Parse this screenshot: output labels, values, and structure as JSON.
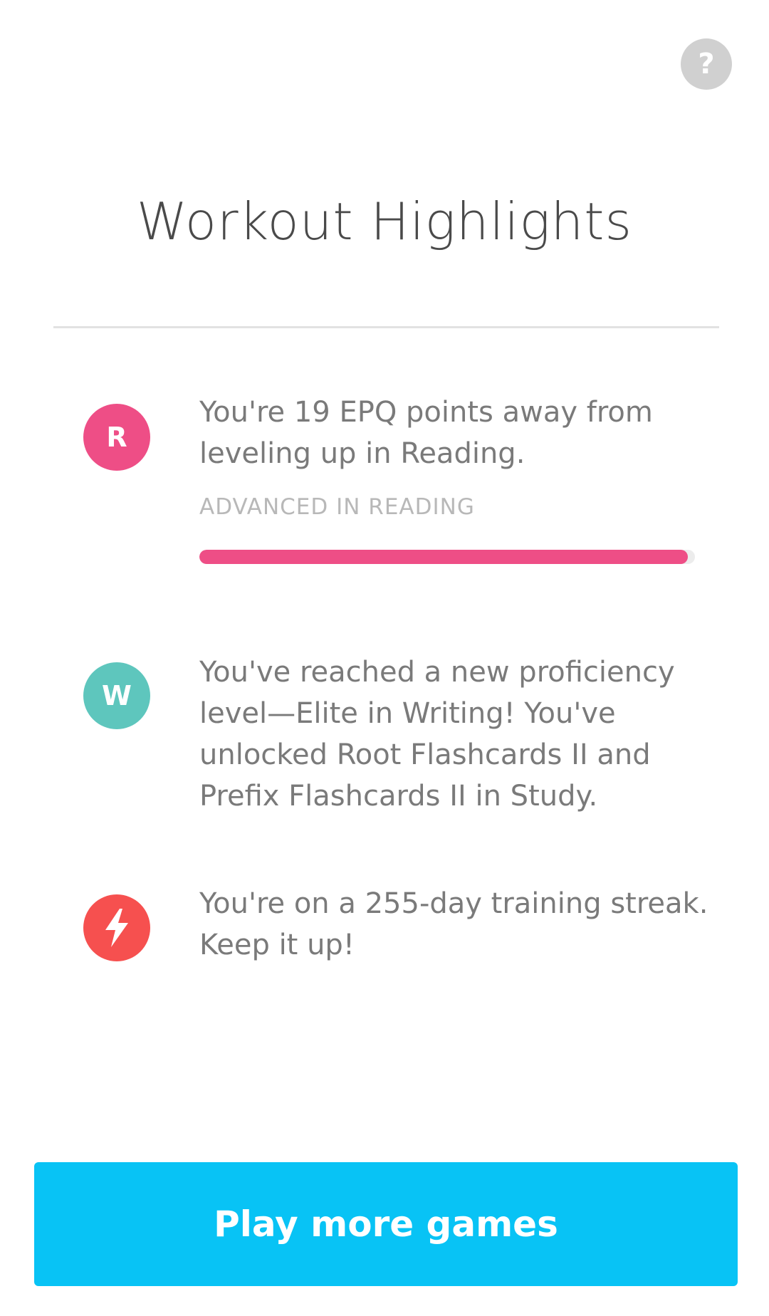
{
  "help": {
    "label": "?"
  },
  "title": "Workout Highlights",
  "highlights": [
    {
      "badge_letter": "R",
      "badge_color": "#ee4e86",
      "message": "You're 19 EPQ points away from leveling up in Reading.",
      "progress_label": "ADVANCED IN READING",
      "progress_value": 0.985,
      "progress_color": "#ee4e86"
    },
    {
      "badge_letter": "W",
      "badge_color": "#5ec6bd",
      "message": "You've reached a new proficiency level—Elite in Writing! You've unlocked Root Flashcards II and Prefix Flashcards II in Study."
    },
    {
      "badge_icon": "lightning-bolt-icon",
      "badge_color": "#f6504f",
      "message": "You're on a 255-day training streak. Keep it up!"
    }
  ],
  "cta": {
    "label": "Play more games",
    "color": "#08c3f5"
  }
}
